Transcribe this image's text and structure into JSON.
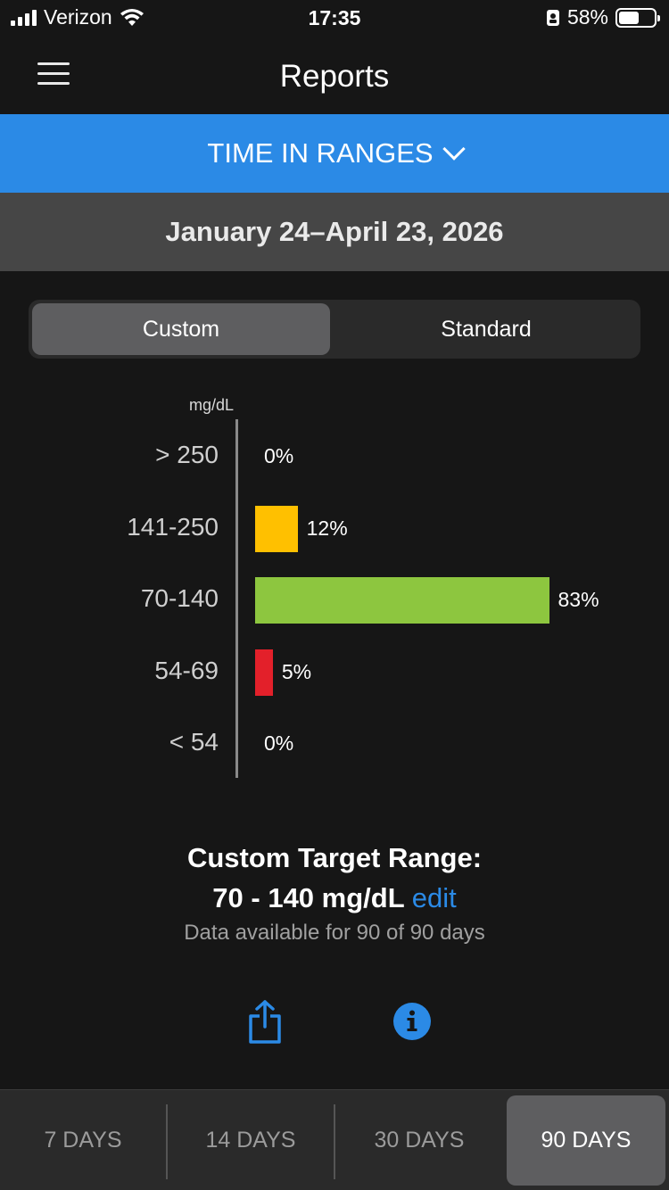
{
  "status_bar": {
    "carrier": "Verizon",
    "time": "17:35",
    "battery_pct": "58%",
    "battery_level": 0.58
  },
  "nav": {
    "title": "Reports"
  },
  "report_selector": {
    "label": "TIME IN RANGES"
  },
  "date_range": "January 24–April 23, 2026",
  "segmented": {
    "custom": "Custom",
    "standard": "Standard",
    "selected": "Custom"
  },
  "chart_data": {
    "type": "bar",
    "orientation": "horizontal",
    "unit_label": "mg/dL",
    "categories": [
      "> 250",
      "141-250",
      "70-140",
      "54-69",
      "< 54"
    ],
    "values": [
      0,
      12,
      83,
      5,
      0
    ],
    "value_labels": [
      "0%",
      "12%",
      "83%",
      "5%",
      "0%"
    ],
    "colors": [
      "#ff9800",
      "#ffc000",
      "#8dc63f",
      "#e3202a",
      "#b0101c"
    ],
    "xlim": [
      0,
      100
    ]
  },
  "target": {
    "heading": "Custom Target Range:",
    "range": "70 - 140 mg/dL",
    "edit": "edit",
    "availability": "Data available for 90 of 90 days"
  },
  "periods": [
    "7 DAYS",
    "14 DAYS",
    "30 DAYS",
    "90 DAYS"
  ],
  "selected_period": "90 DAYS",
  "accent_color": "#2b8ae6"
}
